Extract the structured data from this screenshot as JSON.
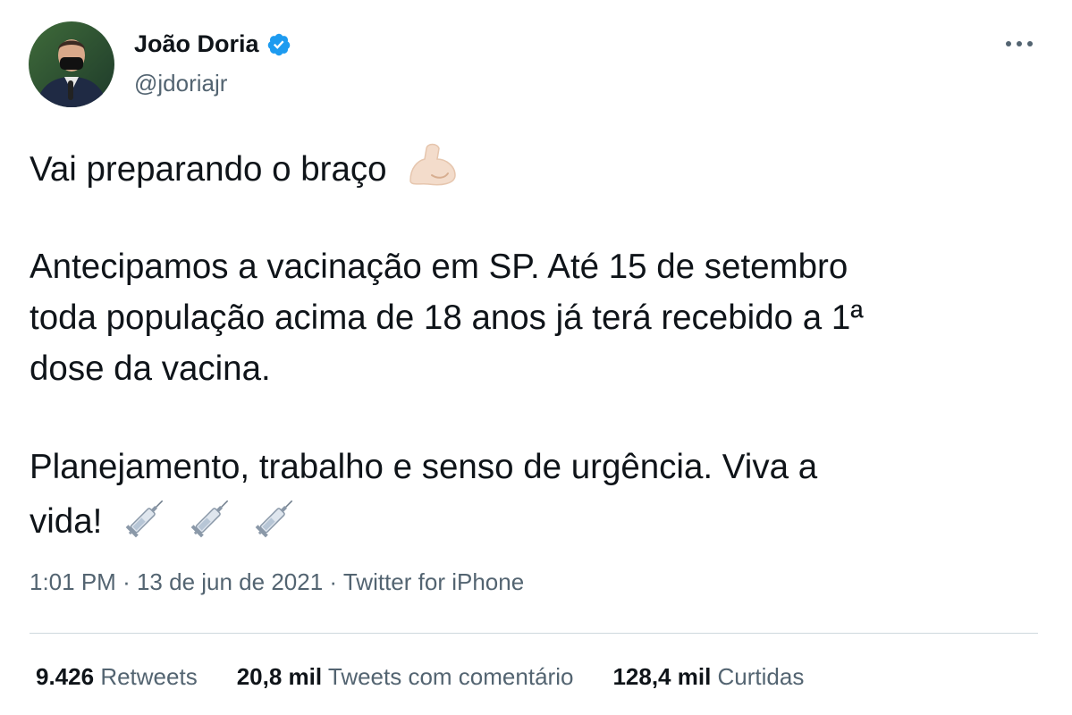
{
  "author": {
    "display_name": "João Doria",
    "handle": "@jdoriajr",
    "verified": true
  },
  "tweet": {
    "line1": "Vai preparando o braço",
    "line1_emoji": "flexed-biceps-icon",
    "para2_line1": "Antecipamos a vacinação em SP. Até 15 de setembro",
    "para2_line2": "toda população acima de 18 anos já terá recebido a 1ª",
    "para2_line3": "dose da vacina.",
    "para3_line1": "Planejamento, trabalho e senso de urgência. Viva a",
    "para3_line2": "vida!",
    "para3_emojis": [
      "syringe-icon",
      "syringe-icon",
      "syringe-icon"
    ]
  },
  "meta": {
    "time": "1:01 PM",
    "separator": "·",
    "date": "13 de jun de 2021",
    "source": "Twitter for iPhone"
  },
  "stats": {
    "retweets_count": "9.426",
    "retweets_label": "Retweets",
    "quotes_count": "20,8 mil",
    "quotes_label": "Tweets com comentário",
    "likes_count": "128,4 mil",
    "likes_label": "Curtidas"
  },
  "colors": {
    "text": "#0f1419",
    "secondary": "#536471",
    "verified": "#1d9bf0",
    "divider": "#cfd9de"
  }
}
